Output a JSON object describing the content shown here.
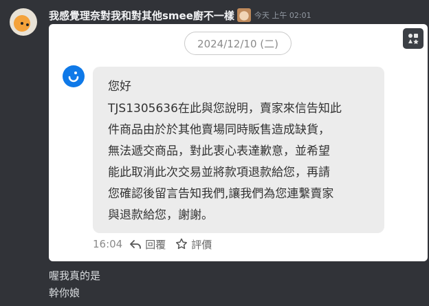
{
  "message": {
    "username": "我感覺理奈對我和對其他smee廚不一樣",
    "timestamp": "今天 上午 02:01"
  },
  "embed": {
    "date_pill": "2024/12/10 (二)",
    "lines": [
      "您好",
      "TJS1305636在此與您說明，賣家來信告知此",
      "件商品由於於其他賣場同時販售造成缺貨，",
      "無法遞交商品，對此衷心表達歉意，並希望",
      "能此取消此次交易並將款項退款給您，再請",
      "您確認後留言告知我們,讓我們為您連繫賣家",
      "與退款給您，謝謝。"
    ],
    "time": "16:04",
    "reply_label": "回覆",
    "rate_label": "評價"
  },
  "followups": [
    "喔我真的是",
    "幹你娘"
  ],
  "colors": {
    "background": "#313338",
    "agent_logo": "#0f79e8",
    "bubble": "#ececec"
  },
  "icons": [
    "avatar",
    "emoji",
    "agent-logo-icon",
    "reply-arrow-icon",
    "star-icon",
    "image-action-icon"
  ]
}
